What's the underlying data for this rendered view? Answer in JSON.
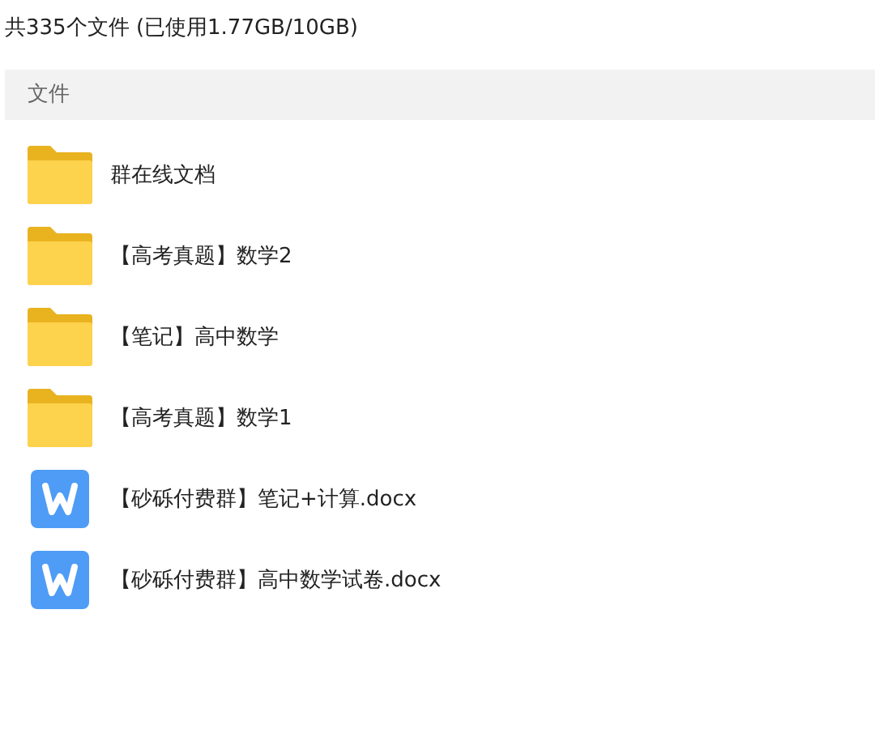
{
  "summary": "共335个文件 (已使用1.77GB/10GB)",
  "list_header": "文件",
  "files": [
    {
      "kind": "folder",
      "name": "群在线文档"
    },
    {
      "kind": "folder",
      "name": "【高考真题】数学2"
    },
    {
      "kind": "folder",
      "name": "【笔记】高中数学"
    },
    {
      "kind": "folder",
      "name": "【高考真题】数学1"
    },
    {
      "kind": "word",
      "name": "【砂砾付费群】笔记+计算.docx"
    },
    {
      "kind": "word",
      "name": "【砂砾付费群】高中数学试卷.docx"
    }
  ]
}
